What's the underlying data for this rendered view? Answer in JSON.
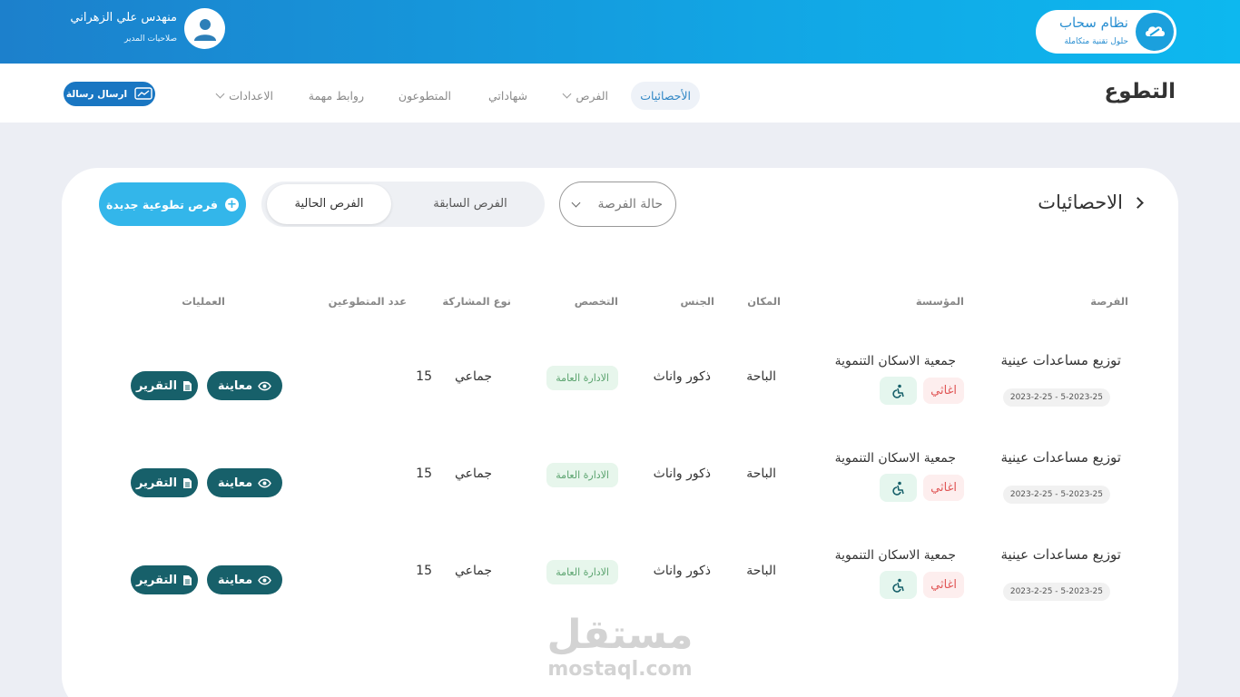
{
  "header": {
    "brand_title": "نظام سحاب",
    "brand_subtitle": "حلول تقنية متكاملة",
    "user_name": "منهدس علي الزهراني",
    "user_role": "صلاحيات المدير"
  },
  "nav": {
    "site_title": "التطوع",
    "items": [
      {
        "label": "الأحصائيات",
        "active": true
      },
      {
        "label": "الفرص",
        "dropdown": true
      },
      {
        "label": "شهاداتي"
      },
      {
        "label": "المتطوعون"
      },
      {
        "label": "روابط مهمة"
      },
      {
        "label": "الاعدادات",
        "dropdown": true
      }
    ],
    "send_message": "ارسال رسالة"
  },
  "toolbar": {
    "section_title": "الاحصائيات",
    "status_placeholder": "حالة الفرصة",
    "tab_previous": "الفرص السابقة",
    "tab_current": "الفرص الحالية",
    "new_button": "فرص تطوعية جديدة"
  },
  "table": {
    "headers": {
      "opportunity": "الفرصة",
      "organization": "المؤسسة",
      "place": "المكان",
      "gender": "الجنس",
      "specialty": "التخصص",
      "participation": "نوع المشاركة",
      "volunteers": "عدد المتطوعين",
      "operations": "العمليات"
    },
    "rows": [
      {
        "title": "توزيع مساعدات عينية",
        "dates": "5-2023-25 - 2023-2-25",
        "organization": "جمعية الاسكان التنموية",
        "tag": "اغاثي",
        "place": "الباحة",
        "gender": "ذكور واناث",
        "specialty": "الادارة العامة",
        "participation": "جماعي",
        "volunteers": "15",
        "view_label": "معاينة",
        "report_label": "التقرير"
      },
      {
        "title": "توزيع مساعدات عينية",
        "dates": "5-2023-25 - 2023-2-25",
        "organization": "جمعية الاسكان التنموية",
        "tag": "اغاثي",
        "place": "الباحة",
        "gender": "ذكور واناث",
        "specialty": "الادارة العامة",
        "participation": "جماعي",
        "volunteers": "15",
        "view_label": "معاينة",
        "report_label": "التقرير"
      },
      {
        "title": "توزيع مساعدات عينية",
        "dates": "5-2023-25 - 2023-2-25",
        "organization": "جمعية الاسكان التنموية",
        "tag": "اغاثي",
        "place": "الباحة",
        "gender": "ذكور واناث",
        "specialty": "الادارة العامة",
        "participation": "جماعي",
        "volunteers": "15",
        "view_label": "معاينة",
        "report_label": "التقرير"
      }
    ]
  },
  "watermark": {
    "arabic": "مستقل",
    "latin": "mostaql.com"
  },
  "colors": {
    "header_start": "#1c80cc",
    "header_end": "#0db8ef",
    "primary_button": "#17606a",
    "new_button": "#33b6ea",
    "relief_tag": "#e05656"
  }
}
